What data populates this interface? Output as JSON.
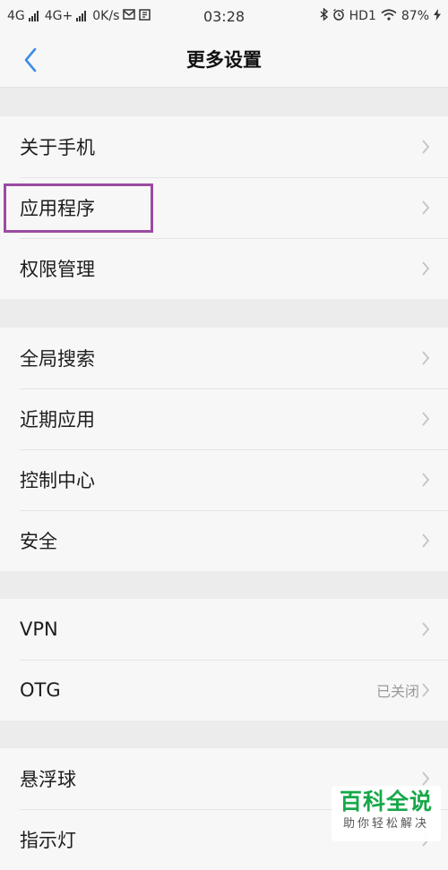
{
  "status_bar": {
    "network1": "4G",
    "network2": "4G+",
    "speed": "0K/s",
    "time": "03:28",
    "hd": "HD1",
    "battery": "87%"
  },
  "header": {
    "title": "更多设置"
  },
  "groups": [
    {
      "items": [
        {
          "label": "关于手机"
        },
        {
          "label": "应用程序"
        },
        {
          "label": "权限管理"
        }
      ]
    },
    {
      "items": [
        {
          "label": "全局搜索"
        },
        {
          "label": "近期应用"
        },
        {
          "label": "控制中心"
        },
        {
          "label": "安全"
        }
      ]
    },
    {
      "items": [
        {
          "label": "VPN"
        },
        {
          "label": "OTG",
          "value": "已关闭"
        }
      ]
    },
    {
      "items": [
        {
          "label": "悬浮球"
        },
        {
          "label": "指示灯"
        }
      ]
    }
  ],
  "watermark": {
    "title": "百科全说",
    "subtitle": "助你轻松解决"
  },
  "colors": {
    "accent": "#3a8ee6",
    "highlight": "#9a4ba2",
    "watermark": "#17a84a"
  }
}
